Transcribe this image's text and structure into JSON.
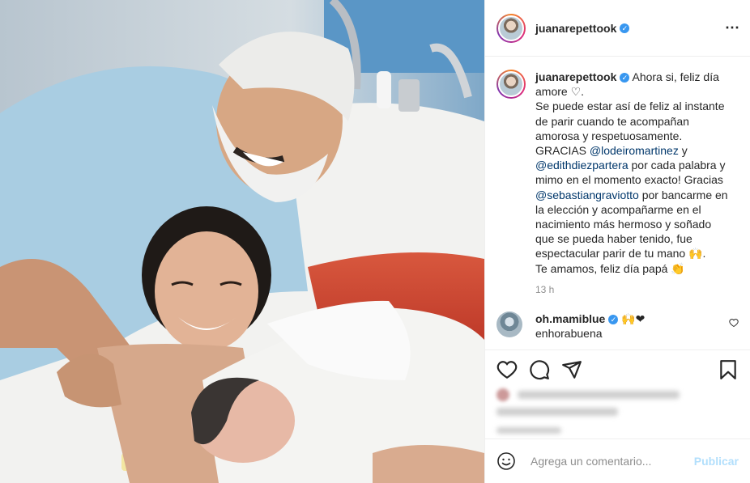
{
  "post": {
    "username": "juanarepettook",
    "verified_mark": "✓",
    "more_icon": "⋯",
    "caption": {
      "line1": "Ahora si, feliz día amore ♡.",
      "line2": "Se puede estar así de feliz al instante de parir cuando te acompañan amorosa y respetuosamente.",
      "line3_pre": "GRACIAS ",
      "mention1": "@lodeiromartinez",
      "line3_mid": " y ",
      "mention2": "@edithdiezpartera",
      "line3_post": " por cada palabra y mimo en el momento exacto! Gracias ",
      "mention3": "@sebastiangraviotto",
      "line4": " por bancarme en la elección y acompañarme en el nacimiento más hermoso y soñado que se pueda haber tenido, fue espectacular parir de tu mano 🙌.",
      "line5": "Te amamos, feliz día papá 👏"
    },
    "timestamp": "13 h"
  },
  "comments": [
    {
      "username": "oh.mamiblue",
      "emojis": "🙌❤",
      "text": "enhorabuena"
    }
  ],
  "icons": {
    "like": "heart-icon",
    "comment": "comment-icon",
    "share": "share-icon",
    "save": "bookmark-icon",
    "emoji": "emoji-icon"
  },
  "add_comment": {
    "placeholder": "Agrega un comentario...",
    "publish_label": "Publicar"
  },
  "colors": {
    "verified": "#3897f0",
    "link": "#00376b",
    "publish_disabled": "#b2dffc"
  }
}
